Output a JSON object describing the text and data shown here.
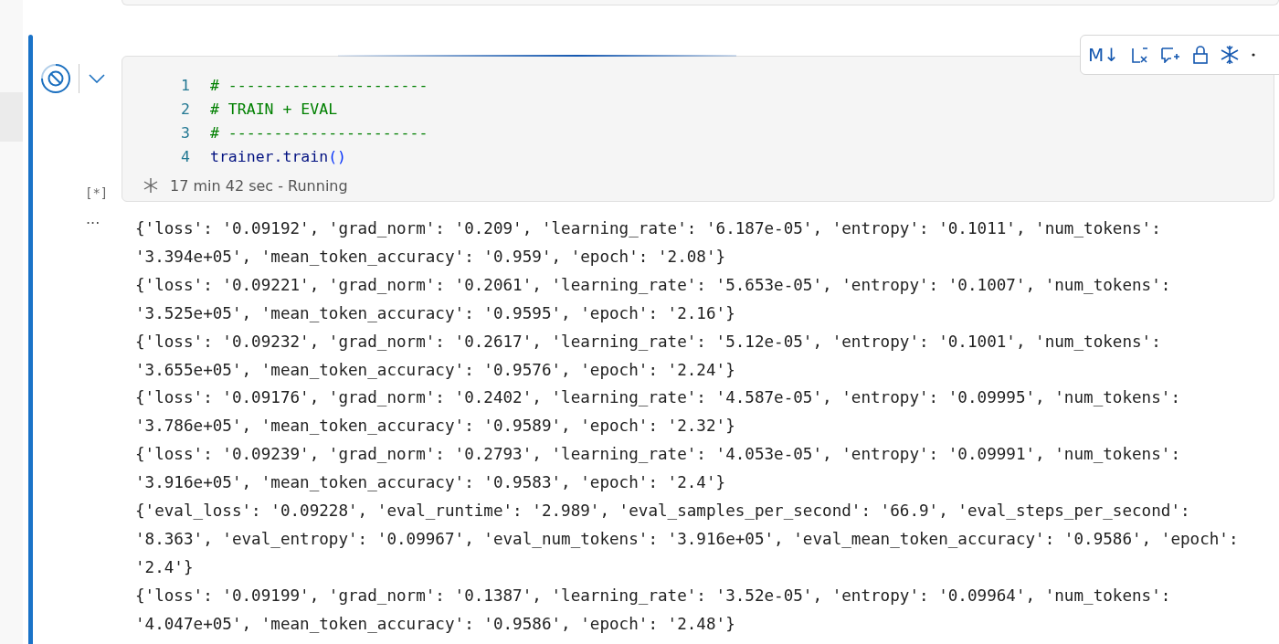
{
  "toolbar": {
    "markdown_label": "M↓"
  },
  "cell": {
    "code_lines": [
      {
        "number": "1",
        "kind": "comment",
        "text": "# ----------------------"
      },
      {
        "number": "2",
        "kind": "comment",
        "text": "# TRAIN + EVAL"
      },
      {
        "number": "3",
        "kind": "comment",
        "text": "# ----------------------"
      },
      {
        "number": "4",
        "kind": "call",
        "text": "trainer.train",
        "parens": "()"
      }
    ],
    "execution_count": "[*]",
    "status": "17 min 42 sec - Running",
    "running": true
  },
  "output": {
    "more": "···",
    "lines": [
      "{'loss': '0.09192', 'grad_norm': '0.209', 'learning_rate': '6.187e-05', 'entropy': '0.1011', 'num_tokens':",
      "'3.394e+05', 'mean_token_accuracy': '0.959', 'epoch': '2.08'}",
      "{'loss': '0.09221', 'grad_norm': '0.2061', 'learning_rate': '5.653e-05', 'entropy': '0.1007', 'num_tokens':",
      "'3.525e+05', 'mean_token_accuracy': '0.9595', 'epoch': '2.16'}",
      "{'loss': '0.09232', 'grad_norm': '0.2617', 'learning_rate': '5.12e-05', 'entropy': '0.1001', 'num_tokens':",
      "'3.655e+05', 'mean_token_accuracy': '0.9576', 'epoch': '2.24'}",
      "{'loss': '0.09176', 'grad_norm': '0.2402', 'learning_rate': '4.587e-05', 'entropy': '0.09995', 'num_tokens':",
      "'3.786e+05', 'mean_token_accuracy': '0.9589', 'epoch': '2.32'}",
      "{'loss': '0.09239', 'grad_norm': '0.2793', 'learning_rate': '4.053e-05', 'entropy': '0.09991', 'num_tokens':",
      "'3.916e+05', 'mean_token_accuracy': '0.9583', 'epoch': '2.4'}",
      "{'eval_loss': '0.09228', 'eval_runtime': '2.989', 'eval_samples_per_second': '66.9', 'eval_steps_per_second':",
      "'8.363', 'eval_entropy': '0.09967', 'eval_num_tokens': '3.916e+05', 'eval_mean_token_accuracy': '0.9586', 'epoch':",
      "'2.4'}",
      "{'loss': '0.09199', 'grad_norm': '0.1387', 'learning_rate': '3.52e-05', 'entropy': '0.09964', 'num_tokens':",
      "'4.047e+05', 'mean_token_accuracy': '0.9586', 'epoch': '2.48'}"
    ]
  }
}
